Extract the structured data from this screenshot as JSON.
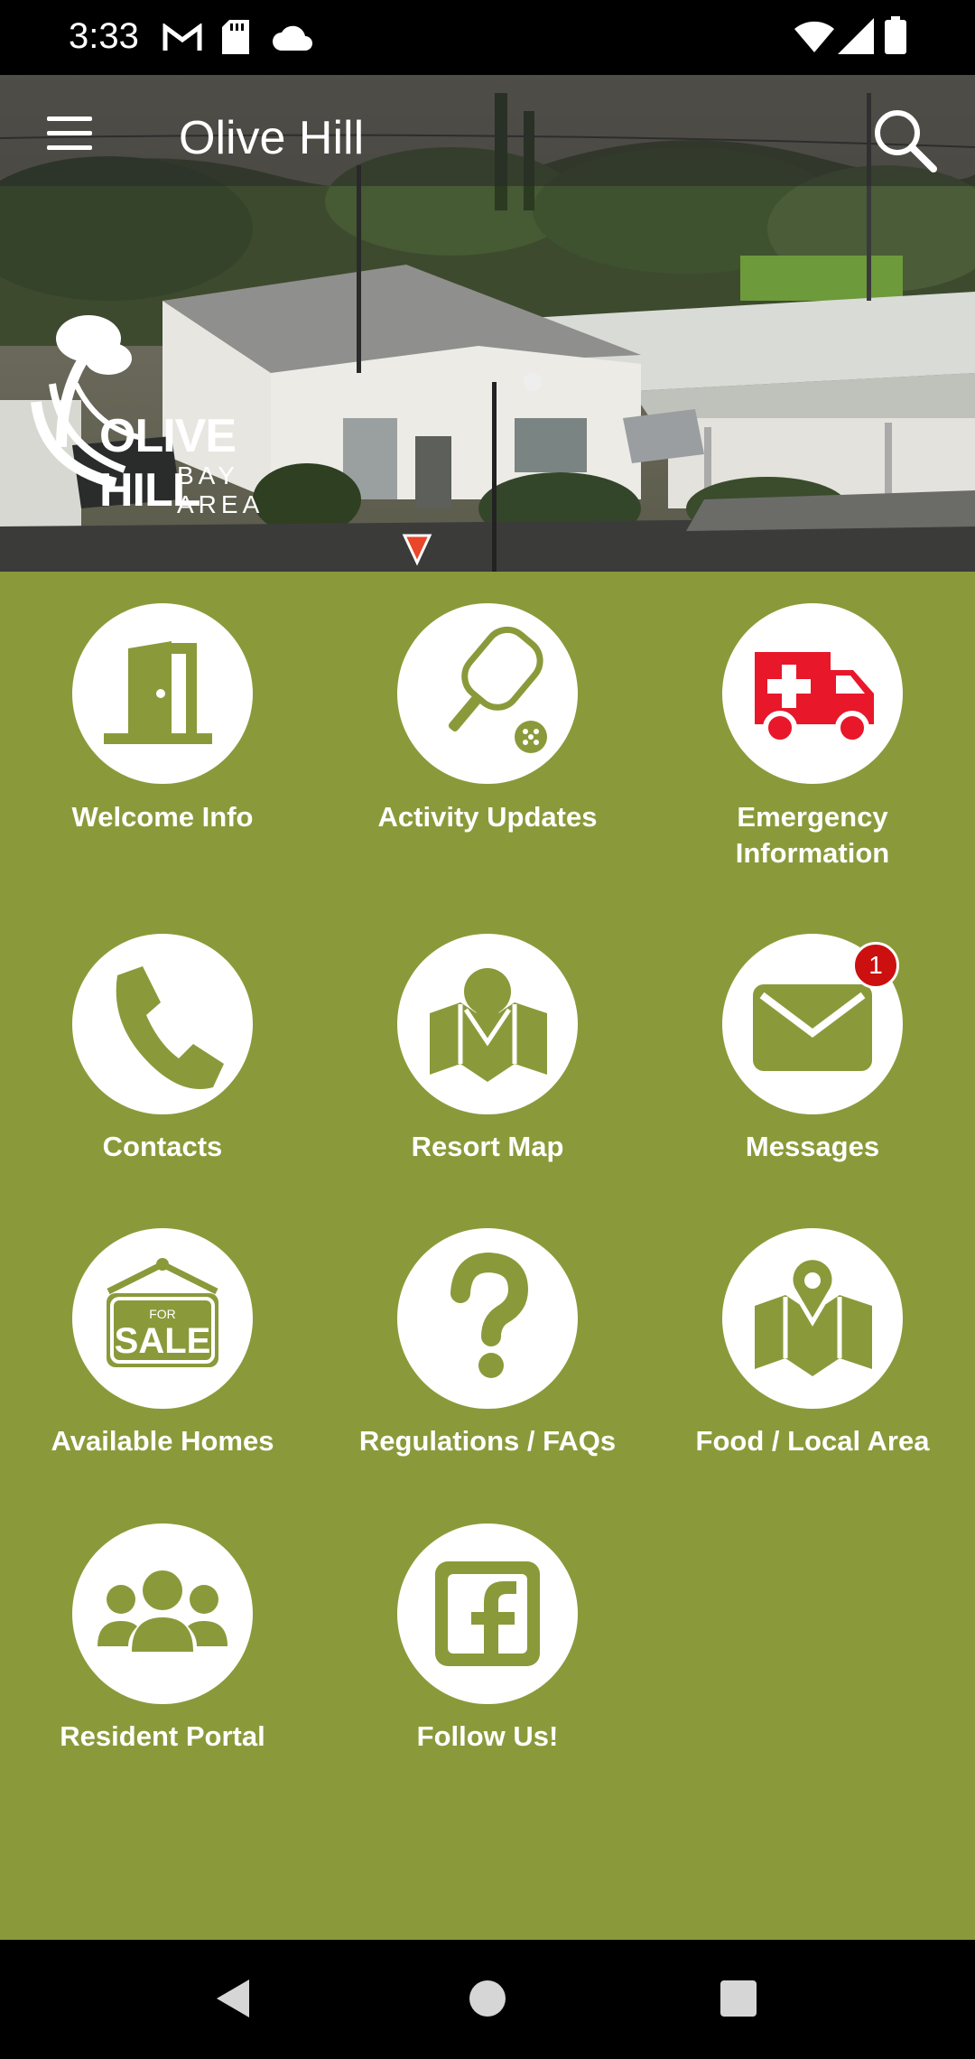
{
  "status_bar": {
    "time": "3:33",
    "left_icons": [
      "gmail-icon",
      "sd-card-icon",
      "cloud-icon"
    ],
    "right_icons": [
      "wifi-icon",
      "signal-icon",
      "battery-icon"
    ]
  },
  "app_bar": {
    "title": "Olive Hill",
    "menu_icon": "hamburger-menu-icon",
    "search_icon": "search-icon"
  },
  "logo": {
    "main": "OLIVE HILL",
    "sub": "BAY AREA"
  },
  "colors": {
    "grid_background": "#8a9a3a",
    "icon_green": "#8a9a3a",
    "emergency_red": "#e8172a",
    "badge_red": "#cc1010"
  },
  "tiles": [
    {
      "label": "Welcome Info",
      "icon": "door-icon"
    },
    {
      "label": "Activity Updates",
      "icon": "pickleball-paddle-icon"
    },
    {
      "label": "Emergency\nInformation",
      "icon": "ambulance-icon"
    },
    {
      "label": "Contacts",
      "icon": "phone-icon"
    },
    {
      "label": "Resort Map",
      "icon": "map-icon"
    },
    {
      "label": "Messages",
      "icon": "envelope-icon",
      "badge": "1"
    },
    {
      "label": "Available Homes",
      "icon": "for-sale-sign-icon"
    },
    {
      "label": "Regulations / FAQs",
      "icon": "question-mark-icon"
    },
    {
      "label": "Food / Local Area",
      "icon": "map-pin-icon"
    },
    {
      "label": "Resident Portal",
      "icon": "group-icon"
    },
    {
      "label": "Follow Us!",
      "icon": "facebook-icon"
    }
  ],
  "sale_sign": {
    "top": "FOR",
    "main": "SALE"
  },
  "nav_bar": {
    "buttons": [
      "back-icon",
      "home-icon",
      "recents-icon"
    ]
  }
}
